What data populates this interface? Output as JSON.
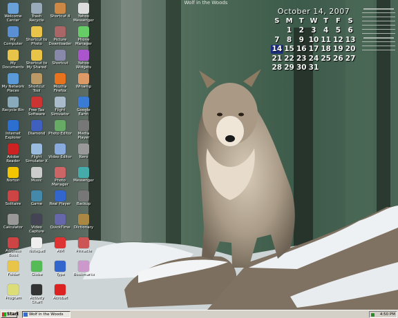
{
  "wallpaper": {
    "title": "Wolf in the Woods"
  },
  "calendar": {
    "month_year": "October 14, 2007",
    "day_headers": [
      "S",
      "M",
      "T",
      "W",
      "T",
      "F",
      "S"
    ],
    "weeks": [
      [
        "",
        "1",
        "2",
        "3",
        "4",
        "5",
        "6"
      ],
      [
        "7",
        "8",
        "9",
        "10",
        "11",
        "12",
        "13"
      ],
      [
        "14",
        "15",
        "16",
        "17",
        "18",
        "19",
        "20"
      ],
      [
        "21",
        "22",
        "23",
        "24",
        "25",
        "26",
        "27"
      ],
      [
        "28",
        "29",
        "30",
        "31",
        "",
        "",
        ""
      ]
    ],
    "today": "14"
  },
  "desktop_icons": [
    {
      "label": "Welcome Center",
      "icon": "welcome-icon",
      "color": "#6aa0d8"
    },
    {
      "label": "Trash Recycle",
      "icon": "recycle-bin-icon",
      "color": "#9ab"
    },
    {
      "label": "Shortcut 4",
      "icon": "app-icon",
      "color": "#c84"
    },
    {
      "label": "Yahoo Messenger",
      "icon": "messenger-icon",
      "color": "#ddd"
    },
    {
      "label": "My Computer",
      "icon": "computer-icon",
      "color": "#5b8fd4"
    },
    {
      "label": "Shortcut to Photo",
      "icon": "folder-icon",
      "color": "#e8c449"
    },
    {
      "label": "Picture Downloader",
      "icon": "app-icon",
      "color": "#a66"
    },
    {
      "label": "Phone Manager",
      "icon": "phone-icon",
      "color": "#6c6"
    },
    {
      "label": "My Documents",
      "icon": "folder-icon",
      "color": "#e8c449"
    },
    {
      "label": "Shortcut to My Shared Folder",
      "icon": "folder-icon",
      "color": "#e8c449"
    },
    {
      "label": "Shortcut",
      "icon": "app-icon",
      "color": "#88a"
    },
    {
      "label": "Yahoo Widgets",
      "icon": "widget-icon",
      "color": "#a5c"
    },
    {
      "label": "My Network Places",
      "icon": "network-icon",
      "color": "#5b9ad8"
    },
    {
      "label": "Shortcut Tool",
      "icon": "app-icon",
      "color": "#b96"
    },
    {
      "label": "Mozilla Firefox",
      "icon": "firefox-icon",
      "color": "#e8731f"
    },
    {
      "label": "Winamp",
      "icon": "winamp-icon",
      "color": "#d96"
    },
    {
      "label": "Recycle Bin",
      "icon": "recycle-bin-icon",
      "color": "#8ab"
    },
    {
      "label": "Free Tax Software",
      "icon": "app-icon",
      "color": "#c33"
    },
    {
      "label": "Flight Simulator",
      "icon": "app-icon",
      "color": "#abc"
    },
    {
      "label": "Google Earth",
      "icon": "globe-icon",
      "color": "#3a7bd5"
    },
    {
      "label": "Internet Explorer",
      "icon": "ie-icon",
      "color": "#2d6ed1"
    },
    {
      "label": "Diamond",
      "icon": "diamond-icon",
      "color": "#4060c0"
    },
    {
      "label": "Photo Editor",
      "icon": "app-icon",
      "color": "#6a6"
    },
    {
      "label": "Media Player",
      "icon": "app-icon",
      "color": "#777"
    },
    {
      "label": "Adobe Reader",
      "icon": "pdf-icon",
      "color": "#c22"
    },
    {
      "label": "Flight Simulator X",
      "icon": "app-icon",
      "color": "#9bd"
    },
    {
      "label": "Video Editor",
      "icon": "app-icon",
      "color": "#8ad"
    },
    {
      "label": "Nero",
      "icon": "app-icon",
      "color": "#999"
    },
    {
      "label": "Norton",
      "icon": "norton-icon",
      "color": "#f3c500"
    },
    {
      "label": "Music",
      "icon": "music-icon",
      "color": "#ccc"
    },
    {
      "label": "Photo Manager",
      "icon": "app-icon",
      "color": "#c66"
    },
    {
      "label": "Messenger",
      "icon": "messenger-icon",
      "color": "#4aa"
    },
    {
      "label": "Solitaire",
      "icon": "cards-icon",
      "color": "#c44"
    },
    {
      "label": "Game",
      "icon": "game-icon",
      "color": "#48a"
    },
    {
      "label": "Real Player",
      "icon": "app-icon",
      "color": "#36c"
    },
    {
      "label": "Backup",
      "icon": "app-icon",
      "color": "#777"
    },
    {
      "label": "Calculator",
      "icon": "calculator-icon",
      "color": "#999"
    },
    {
      "label": "Video Capture",
      "icon": "video-icon",
      "color": "#445"
    },
    {
      "label": "QuickTime",
      "icon": "quicktime-icon",
      "color": "#66a"
    },
    {
      "label": "Dictionary",
      "icon": "app-icon",
      "color": "#a84"
    },
    {
      "label": "Address Book",
      "icon": "book-icon",
      "color": "#c44"
    },
    {
      "label": "Notepad",
      "icon": "notepad-icon",
      "color": "#eee"
    },
    {
      "label": "AIM",
      "icon": "aim-icon",
      "color": "#d33"
    },
    {
      "label": "Pinnacle",
      "icon": "app-icon",
      "color": "#c55"
    },
    {
      "label": "Folder",
      "icon": "folder-icon",
      "color": "#e8c449"
    },
    {
      "label": "Globe",
      "icon": "globe-icon",
      "color": "#5b5"
    },
    {
      "label": "Type",
      "icon": "font-icon",
      "color": "#36c"
    },
    {
      "label": "Bookmarks",
      "icon": "app-icon",
      "color": "#c9c"
    },
    {
      "label": "Program",
      "icon": "app-icon",
      "color": "#dd7"
    },
    {
      "label": "Activity Chart",
      "icon": "app-icon",
      "color": "#333"
    },
    {
      "label": "Acrobat",
      "icon": "acrobat-icon",
      "color": "#d22"
    }
  ],
  "taskbar": {
    "start_label": "Start",
    "window_label": "Wolf in the Woods",
    "clock": "4:50 PM"
  }
}
